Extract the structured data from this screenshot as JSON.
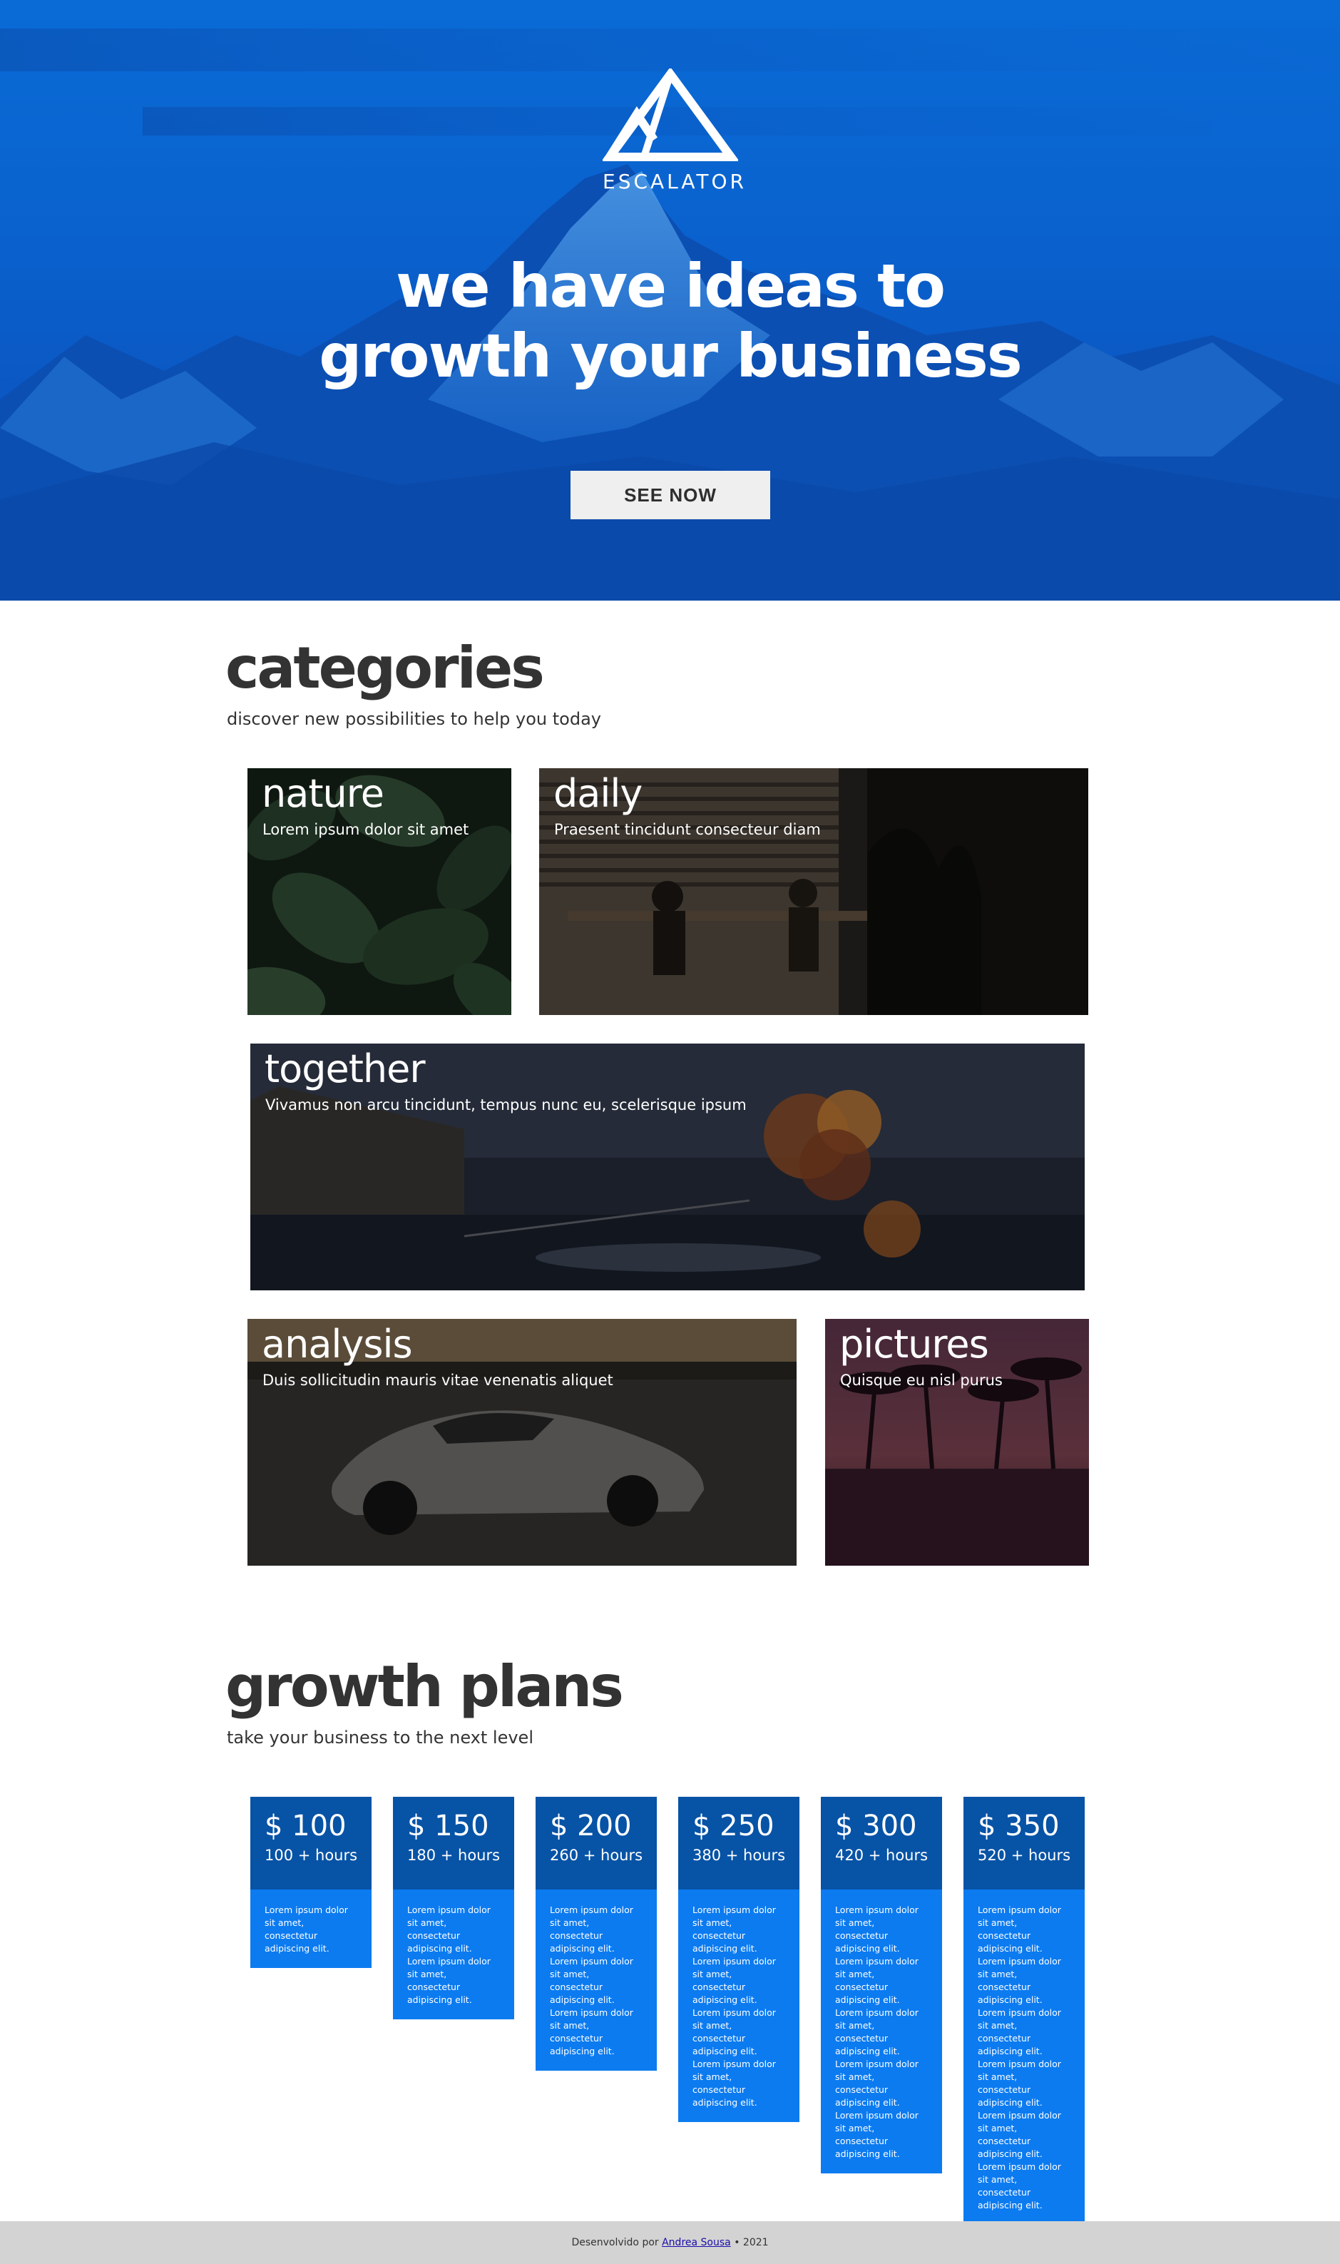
{
  "brand": {
    "name": "ESCALATOR"
  },
  "hero": {
    "title_line1": "we have ideas to",
    "title_line2": "growth your business",
    "button_label": "SEE NOW"
  },
  "categories": {
    "title": "categories",
    "subtitle": "discover new possibilities to help you today",
    "items": [
      {
        "title": "nature",
        "text": "Lorem ipsum dolor sit amet"
      },
      {
        "title": "daily",
        "text": "Praesent tincidunt consecteur diam"
      },
      {
        "title": "together",
        "text": "Vivamus non arcu tincidunt, tempus nunc eu, scelerisque ipsum"
      },
      {
        "title": "analysis",
        "text": "Duis sollicitudin mauris vitae venenatis aliquet"
      },
      {
        "title": "pictures",
        "text": "Quisque eu nisl purus"
      }
    ]
  },
  "plans": {
    "title": "growth plans",
    "subtitle": "take your business to the next level",
    "lorem_lines": [
      "Lorem ipsum dolor",
      "sit amet, consectetur",
      "adipiscing elit."
    ],
    "items": [
      {
        "price": "$ 100",
        "hours": "100 + hours",
        "paragraphs": 1
      },
      {
        "price": "$ 150",
        "hours": "180 + hours",
        "paragraphs": 2
      },
      {
        "price": "$ 200",
        "hours": "260 + hours",
        "paragraphs": 3
      },
      {
        "price": "$ 250",
        "hours": "380 + hours",
        "paragraphs": 4
      },
      {
        "price": "$ 300",
        "hours": "420 + hours",
        "paragraphs": 5
      },
      {
        "price": "$ 350",
        "hours": "520 + hours",
        "paragraphs": 6
      }
    ]
  },
  "footer": {
    "prefix": "Desenvolvido por",
    "author": "Andrea Sousa",
    "suffix": "• 2021"
  },
  "colors": {
    "hero_blue": "#0a63cf",
    "plan_head": "#0753a6",
    "plan_body": "#0c7bf0",
    "footer_bg": "#d3d3d3",
    "heading_text": "#333333"
  }
}
